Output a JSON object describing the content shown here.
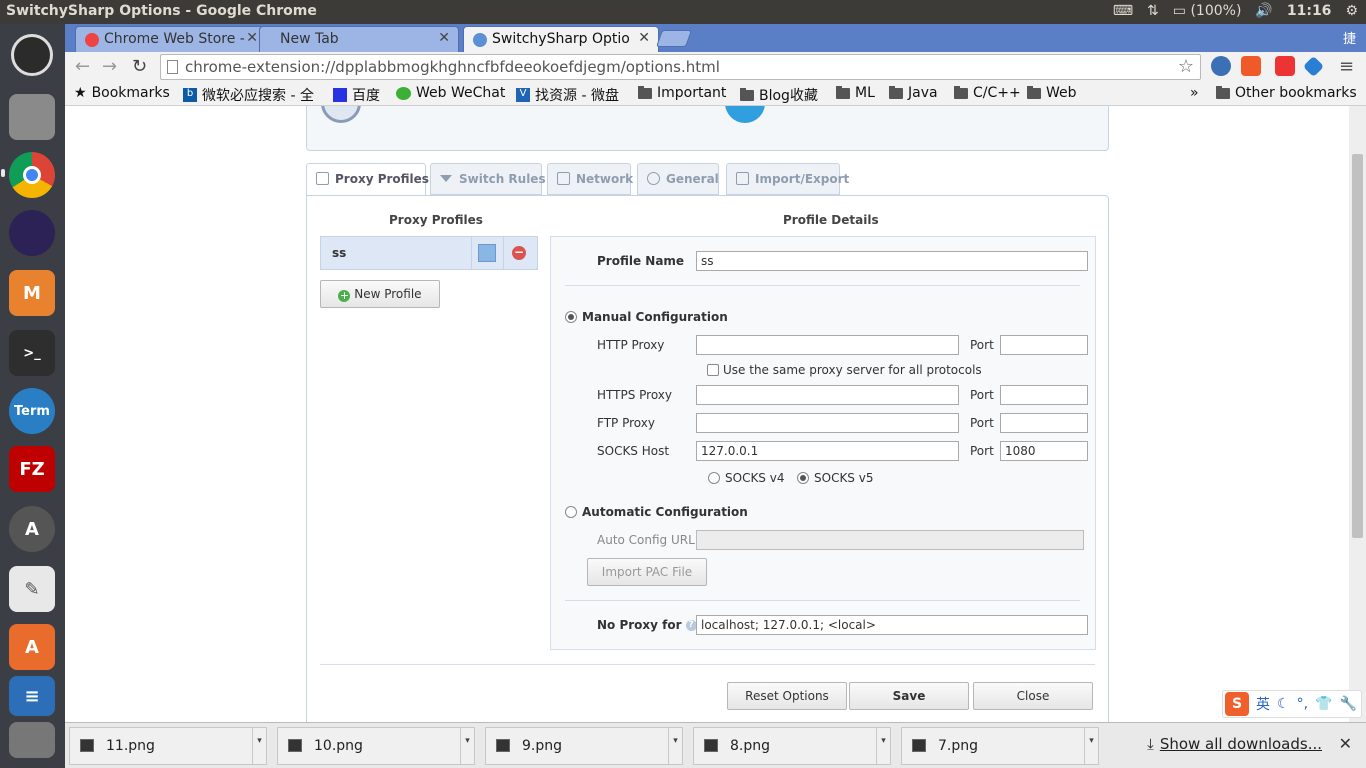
{
  "os": {
    "window_title": "SwitchySharp Options - Google Chrome",
    "battery": "(100%)",
    "clock": "11:16"
  },
  "browser": {
    "tabs": [
      {
        "label": "Chrome Web Store -"
      },
      {
        "label": "New Tab"
      },
      {
        "label": "SwitchySharp Optio"
      }
    ],
    "ime_corner": "捷",
    "url": "chrome-extension://dpplabbmogkhghncfbfdeeokoefdjegm/options.html",
    "bookmarks": [
      {
        "label": "Bookmarks"
      },
      {
        "label": "微软必应搜索 - 全"
      },
      {
        "label": "百度"
      },
      {
        "label": "Web WeChat"
      },
      {
        "label": "找资源 - 微盘"
      },
      {
        "label": "Important"
      },
      {
        "label": "Blog收藏"
      },
      {
        "label": "ML"
      },
      {
        "label": "Java"
      },
      {
        "label": "C/C++"
      },
      {
        "label": "Web"
      }
    ],
    "overflow": "»",
    "other_bookmarks": "Other bookmarks"
  },
  "options": {
    "tabs": [
      {
        "label": "Proxy Profiles"
      },
      {
        "label": "Switch Rules"
      },
      {
        "label": "Network"
      },
      {
        "label": "General"
      },
      {
        "label": "Import/Export"
      }
    ],
    "profiles_heading": "Proxy Profiles",
    "details_heading": "Profile Details",
    "profiles": [
      {
        "name": "ss",
        "color": "#8ab6e6"
      }
    ],
    "new_profile": "New Profile",
    "profile_name_label": "Profile Name",
    "profile_name_value": "ss",
    "manual_config": "Manual Configuration",
    "http_proxy_label": "HTTP Proxy",
    "http_proxy_value": "",
    "port_label": "Port",
    "http_port_value": "",
    "same_proxy_label": "Use the same proxy server for all protocols",
    "https_proxy_label": "HTTPS Proxy",
    "https_proxy_value": "",
    "https_port_value": "",
    "ftp_proxy_label": "FTP Proxy",
    "ftp_proxy_value": "",
    "ftp_port_value": "",
    "socks_host_label": "SOCKS Host",
    "socks_host_value": "127.0.0.1",
    "socks_port_value": "1080",
    "socks_v4": "SOCKS v4",
    "socks_v5": "SOCKS v5",
    "auto_config": "Automatic Configuration",
    "auto_config_url_label": "Auto Config URL",
    "auto_config_url_value": "",
    "import_pac": "Import PAC File",
    "no_proxy_label": "No Proxy for",
    "no_proxy_value": "localhost; 127.0.0.1; <local>",
    "reset": "Reset Options",
    "save": "Save",
    "close": "Close"
  },
  "downloads": {
    "items": [
      {
        "name": "11.png"
      },
      {
        "name": "10.png"
      },
      {
        "name": "9.png"
      },
      {
        "name": "8.png"
      },
      {
        "name": "7.png"
      }
    ],
    "show_all": "Show all downloads...",
    "close": "✕"
  },
  "ime": {
    "logo": "S",
    "lang": "英"
  },
  "colors": {
    "tabstrip": "#5a7fc7",
    "launcher": "#3b3f45",
    "topbar": "#3c3b37",
    "profile_color": "#8ab6e6"
  }
}
